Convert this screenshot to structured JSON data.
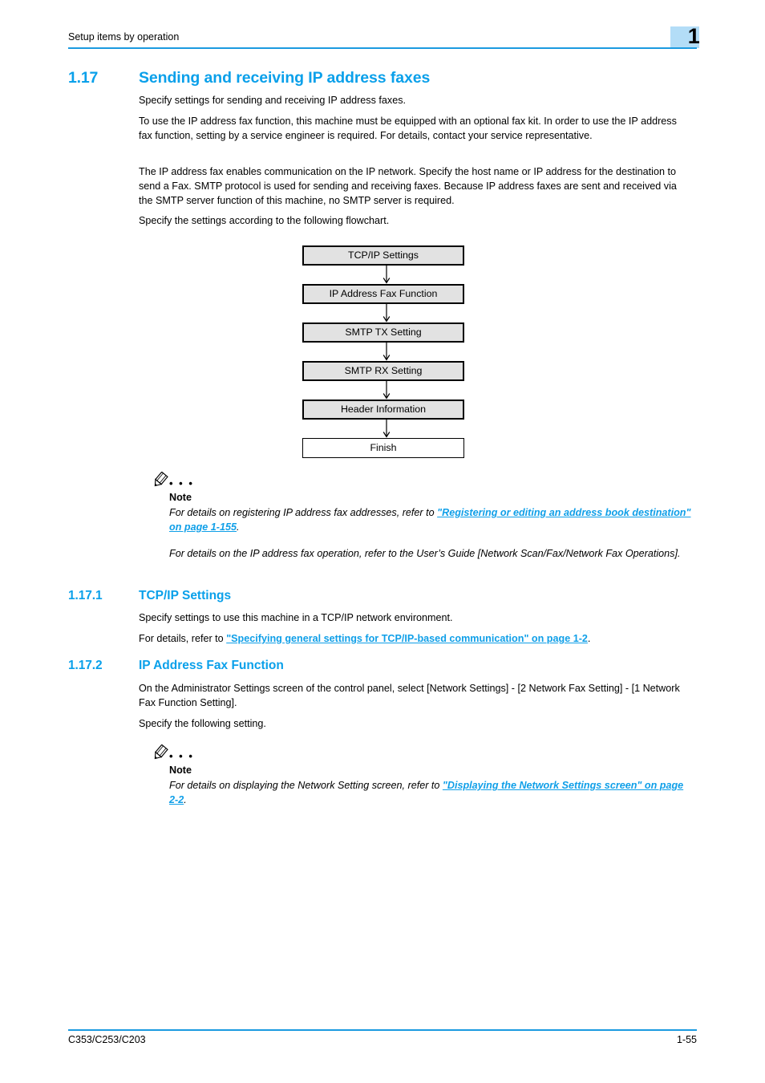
{
  "header": {
    "title": "Setup items by operation",
    "chapter_number": "1",
    "accent_color": "#0aa0ea",
    "badge_color": "#b3ddf7"
  },
  "section": {
    "number": "1.17",
    "title": "Sending and receiving IP address faxes",
    "paragraphs": [
      "Specify settings for sending and receiving IP address faxes.",
      "To use the IP address fax function, this machine must be equipped with an optional fax kit. In order to use the IP address fax function, setting by a service engineer is required. For details, contact your service representative.",
      "The IP address fax enables communication on the IP network. Specify the host name or IP address for the destination to send a Fax. SMTP protocol is used for sending and receiving faxes. Because IP address faxes are sent and received via the SMTP server function of this machine, no SMTP server is required.",
      "Specify the settings according to the following flowchart."
    ]
  },
  "flowchart": {
    "dots": "• • •",
    "steps": [
      "TCP/IP Settings",
      "IP Address Fax Function",
      "SMTP TX Setting",
      "SMTP RX Setting",
      "Header Information",
      "Finish"
    ]
  },
  "note1": {
    "dots": "• • •",
    "label": "Note",
    "line1_pre": "For details on registering IP address fax addresses, refer to ",
    "line1_link": "\"Registering or editing an address book destination\" on page 1-155",
    "line1_post": ".",
    "line2": "For details on the IP address fax operation, refer to the User’s Guide [Network Scan/Fax/Network Fax Operations]."
  },
  "subsection1": {
    "number": "1.17.1",
    "title": "TCP/IP Settings",
    "paragraph": "Specify settings to use this machine in a TCP/IP network environment.",
    "ref_pre": "For details, refer to ",
    "ref_link": "\"Specifying general settings for TCP/IP-based communication\" on page 1-2",
    "ref_post": "."
  },
  "subsection2": {
    "number": "1.17.2",
    "title": "IP Address Fax Function",
    "paragraph1": "On the Administrator Settings screen of the control panel, select [Network Settings] - [2 Network Fax Setting] - [1 Network Fax Function Setting].",
    "paragraph2": "Specify the following setting."
  },
  "note2": {
    "dots": "• • •",
    "label": "Note",
    "line1_pre": "For details on displaying the Network Setting screen, refer to ",
    "line1_link": "\"Displaying the Network Settings screen\" on page 2-2",
    "line1_post": "."
  },
  "footer": {
    "left": "C353/C253/C203",
    "right": "1-55"
  }
}
